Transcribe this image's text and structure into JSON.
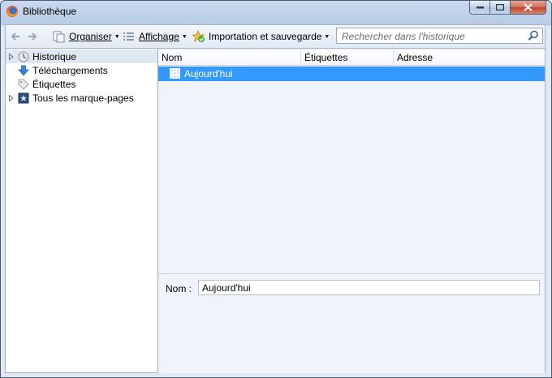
{
  "window": {
    "title": "Bibliothèque"
  },
  "toolbar": {
    "organiser_label": "Organiser",
    "affichage_label": "Affichage",
    "import_label": "Importation et sauvegarde",
    "search_placeholder": "Rechercher dans l'historique"
  },
  "sidebar": {
    "items": [
      {
        "label": "Historique",
        "icon": "clock-icon"
      },
      {
        "label": "Téléchargements",
        "icon": "download-arrow-icon"
      },
      {
        "label": "Étiquettes",
        "icon": "tag-icon"
      },
      {
        "label": "Tous les marque-pages",
        "icon": "bookmark-star-icon"
      }
    ]
  },
  "table": {
    "columns": [
      "Nom",
      "Étiquettes",
      "Adresse"
    ],
    "rows": [
      {
        "name": "Aujourd'hui",
        "icon": "calendar-icon"
      }
    ]
  },
  "details": {
    "name_label": "Nom :",
    "name_value": "Aujourd'hui"
  },
  "colors": {
    "selection": "#3399ff",
    "sidebar_selected": "#dfe7f2"
  }
}
